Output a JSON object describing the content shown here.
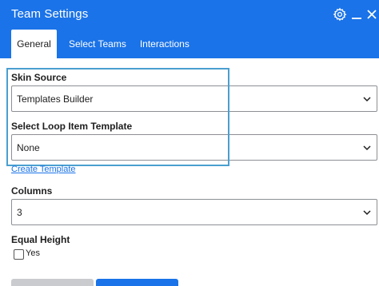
{
  "window": {
    "title": "Team Settings",
    "icons": [
      "gear-icon",
      "minimize-icon",
      "close-icon"
    ]
  },
  "tabs": [
    {
      "label": "General",
      "active": true
    },
    {
      "label": "Select Teams",
      "active": false
    },
    {
      "label": "Interactions",
      "active": false
    }
  ],
  "form": {
    "skin_source": {
      "label": "Skin Source",
      "value": "Templates Builder"
    },
    "loop_item_template": {
      "label": "Select Loop Item Template",
      "value": "None"
    },
    "create_template_link": "Create Template",
    "columns": {
      "label": "Columns",
      "value": "3"
    },
    "equal_height": {
      "label": "Equal Height",
      "option": "Yes",
      "checked": false
    }
  },
  "colors": {
    "header": "#1a73e8",
    "highlight_border": "#4a9fd0",
    "link": "#1a73e8"
  }
}
